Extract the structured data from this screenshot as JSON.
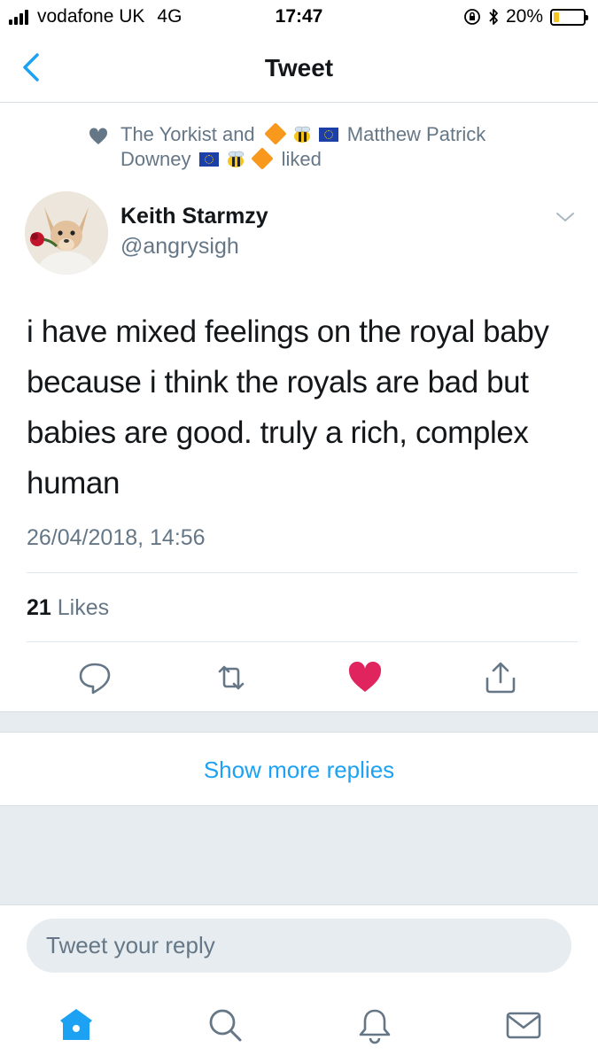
{
  "status_bar": {
    "carrier": "vodafone UK",
    "network": "4G",
    "time": "17:47",
    "battery_percent": "20%",
    "battery_level": 0.2
  },
  "nav": {
    "title": "Tweet",
    "back_icon": "chevron-left-icon"
  },
  "social_context": {
    "liker_one": "The Yorkist and",
    "liker_two_part_one": "Matthew Patrick",
    "liker_two_part_two": "Downey",
    "action": "liked"
  },
  "tweet": {
    "author_name": "Keith Starmzy",
    "author_handle": "@angrysigh",
    "text": "i have mixed feelings on the royal baby because i think the royals are bad but babies are good. truly a rich, complex human",
    "timestamp": "26/04/2018, 14:56",
    "likes_count": "21",
    "likes_label": "Likes"
  },
  "actions": [
    "reply-icon",
    "retweet-icon",
    "like-icon",
    "share-icon"
  ],
  "show_more_label": "Show more replies",
  "reply": {
    "placeholder": "Tweet your reply"
  },
  "tab_bar": [
    "home-icon",
    "search-icon",
    "notifications-icon",
    "messages-icon"
  ],
  "colors": {
    "accent": "#1da1f2",
    "like": "#e0245e",
    "secondary_text": "#657786",
    "band": "#e6ecf0"
  }
}
